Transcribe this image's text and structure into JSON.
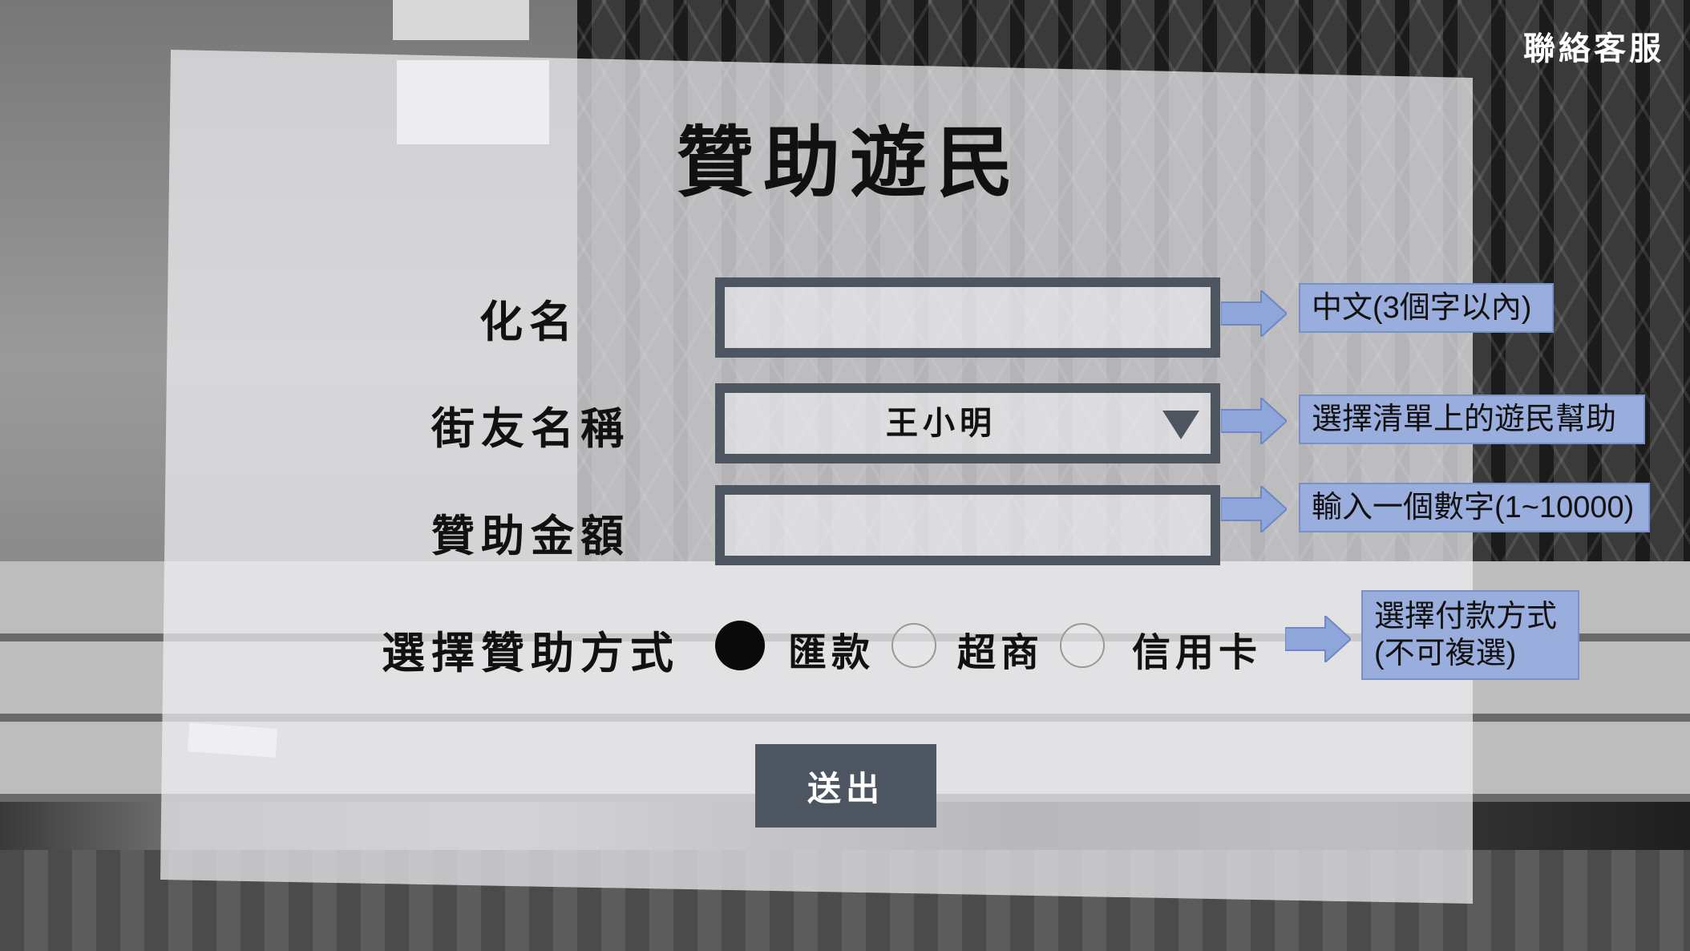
{
  "header": {
    "contact_label": "聯絡客服",
    "title": "贊助遊民"
  },
  "form": {
    "nickname": {
      "label": "化名",
      "value": "",
      "hint": "中文(3個字以內)"
    },
    "recipient": {
      "label": "街友名稱",
      "selected": "王小明",
      "hint": "選擇清單上的遊民幫助"
    },
    "amount": {
      "label": "贊助金額",
      "value": "",
      "hint": "輸入一個數字(1~10000)"
    },
    "payment": {
      "label": "選擇贊助方式",
      "options": [
        {
          "label": "匯款",
          "selected": true
        },
        {
          "label": "超商",
          "selected": false
        },
        {
          "label": "信用卡",
          "selected": false
        }
      ],
      "hint_line1": "選擇付款方式",
      "hint_line2": "(不可複選)"
    },
    "submit_label": "送出"
  },
  "colors": {
    "field_border": "#4d5561",
    "hint_box": "#9aaede",
    "arrow": "#8ea6da",
    "button": "#4d5561"
  }
}
